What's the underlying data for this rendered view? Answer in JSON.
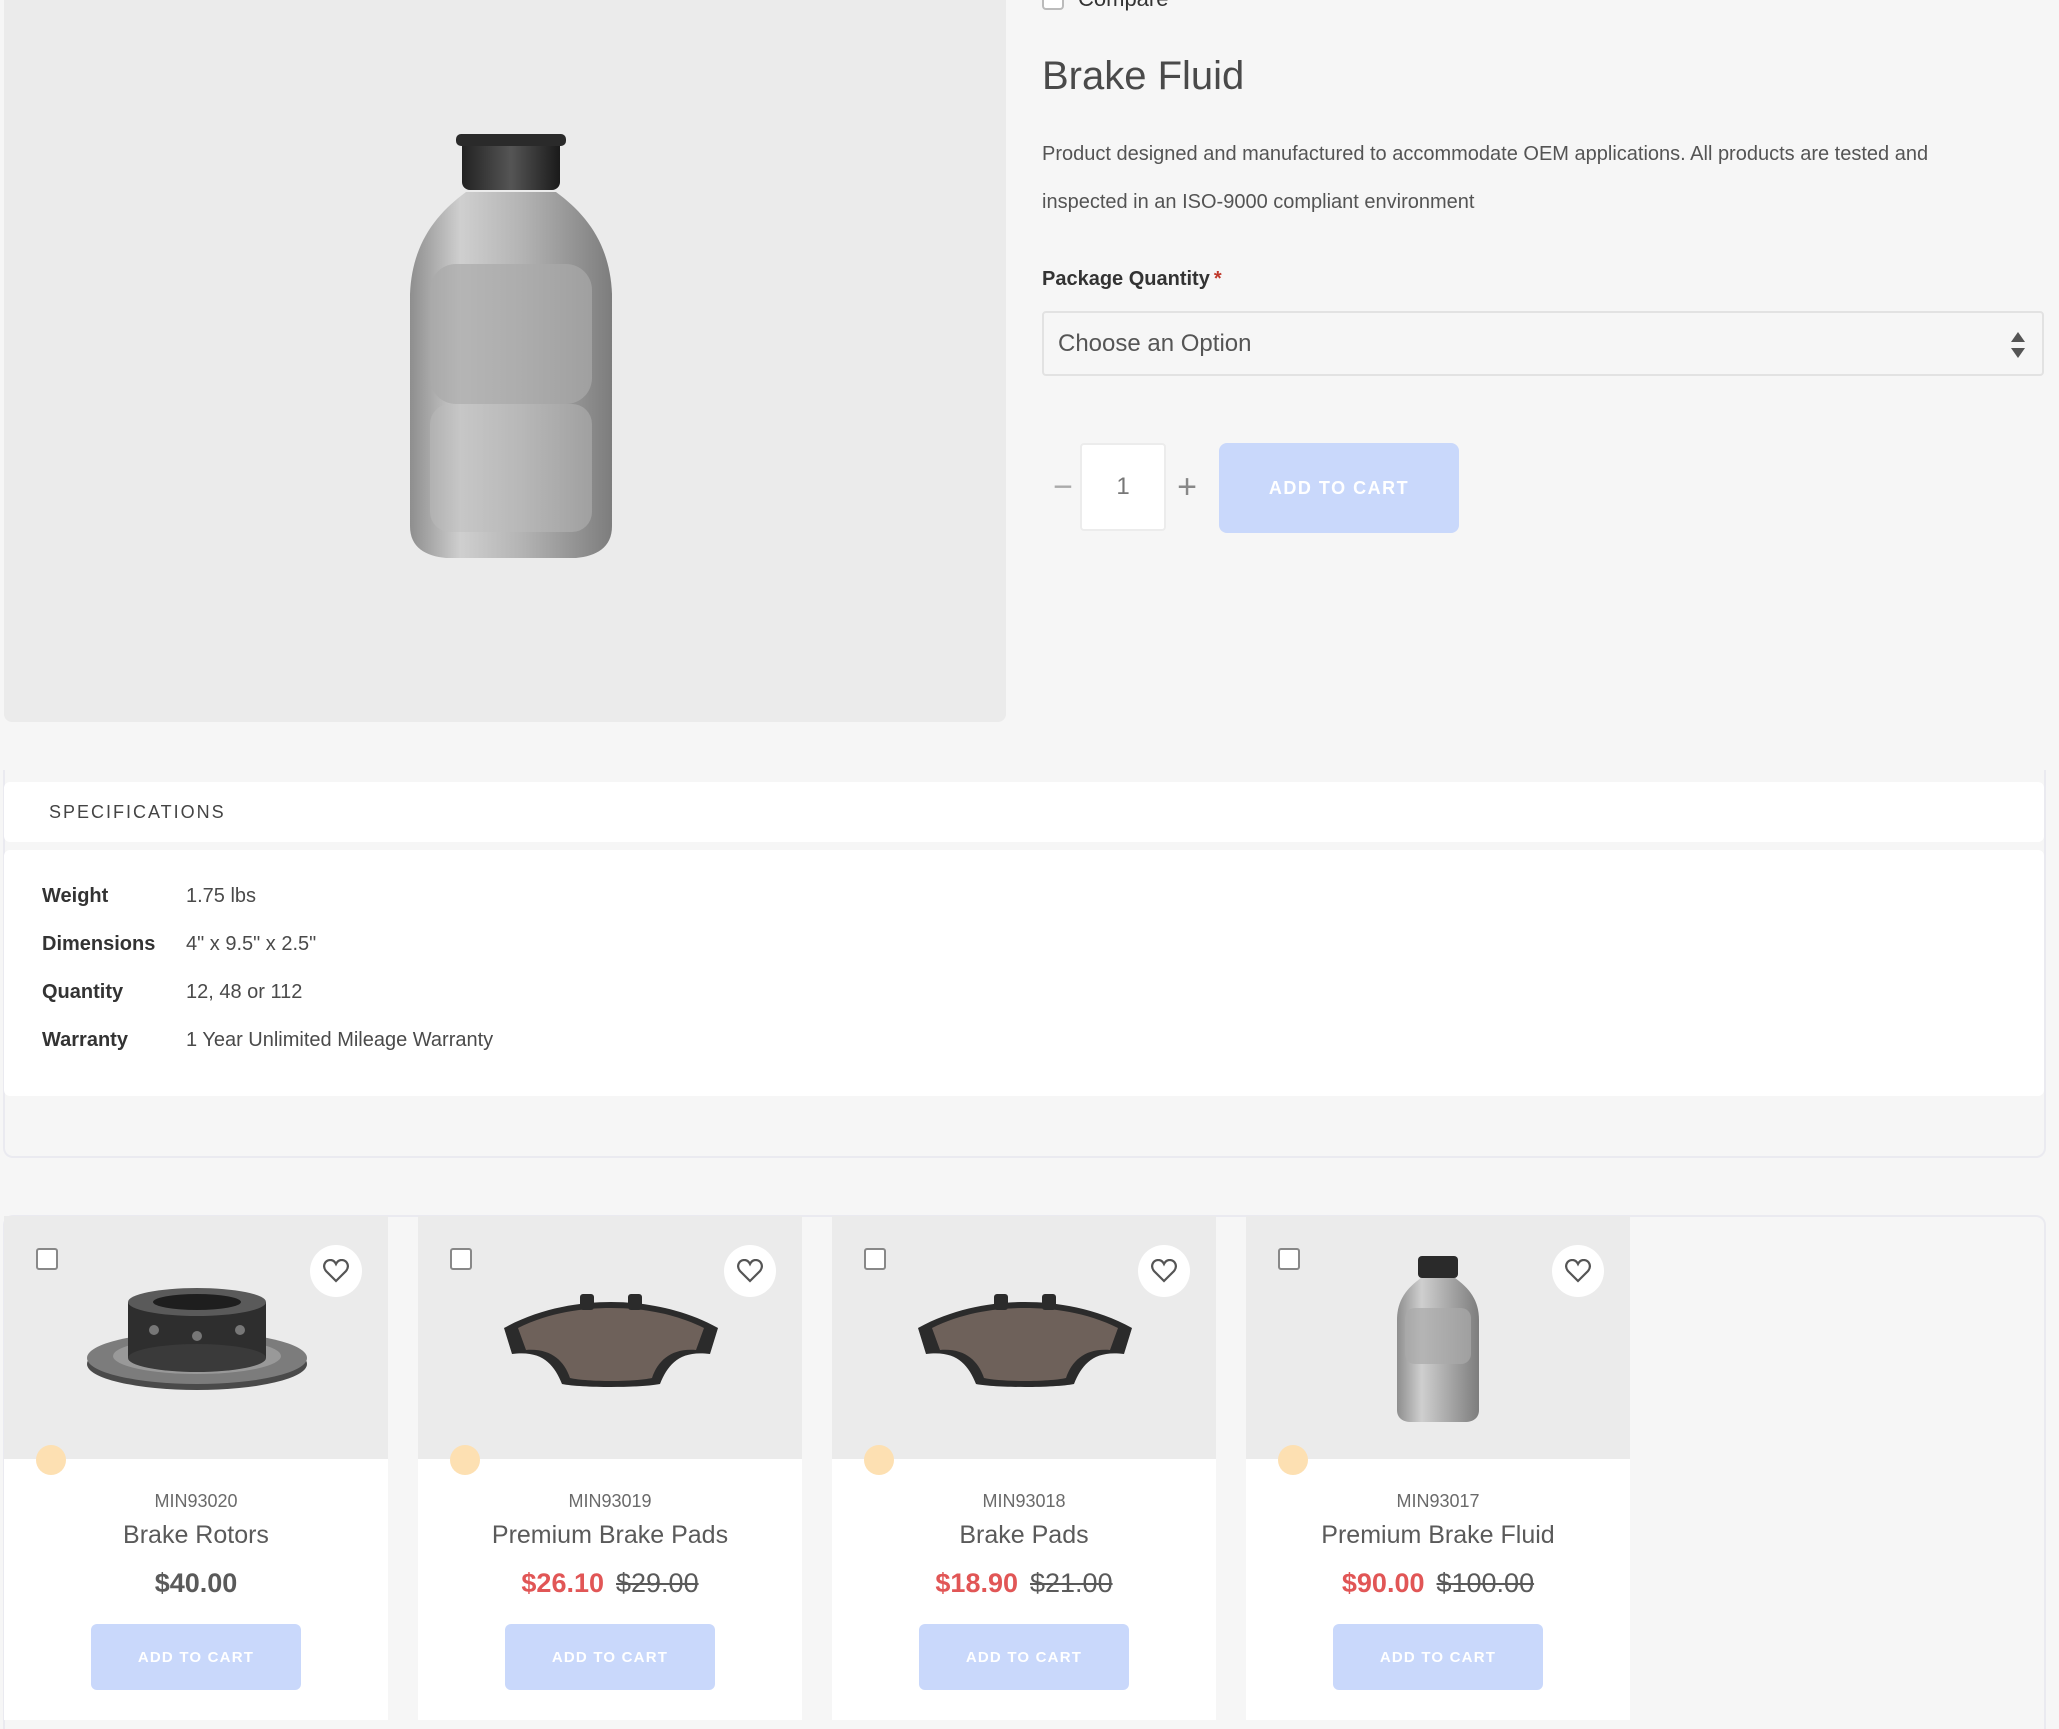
{
  "product": {
    "compare_label": "Compare",
    "title": "Brake Fluid",
    "description": "Product designed and manufactured to accommodate OEM applications. All products are tested and inspected in an ISO-9000 compliant environment",
    "option_label": "Package Quantity",
    "required_mark": "*",
    "option_selected": "Choose an Option",
    "quantity": "1",
    "minus_label": "−",
    "plus_label": "+",
    "add_to_cart": "ADD TO CART",
    "colors": {
      "button_bg": "#c9d8fb",
      "sale": "#e15656",
      "required": "#c0392b"
    }
  },
  "specs": {
    "tab_label": "SPECIFICATIONS",
    "rows": [
      {
        "key": "Weight",
        "value": "1.75 lbs"
      },
      {
        "key": "Dimensions",
        "value": "4\" x 9.5\" x 2.5\""
      },
      {
        "key": "Quantity",
        "value": "12, 48 or 112"
      },
      {
        "key": "Warranty",
        "value": "1 Year Unlimited Mileage Warranty"
      }
    ]
  },
  "related": [
    {
      "sku": "MIN93020",
      "name": "Brake Rotors",
      "price": "$40.00",
      "sale_price": "",
      "old_price": "",
      "button": "ADD TO CART",
      "image": "brake-rotor-icon"
    },
    {
      "sku": "MIN93019",
      "name": "Premium Brake Pads",
      "price": "",
      "sale_price": "$26.10",
      "old_price": "$29.00",
      "button": "ADD TO CART",
      "image": "brake-pad-icon"
    },
    {
      "sku": "MIN93018",
      "name": "Brake Pads",
      "price": "",
      "sale_price": "$18.90",
      "old_price": "$21.00",
      "button": "ADD TO CART",
      "image": "brake-pad-icon"
    },
    {
      "sku": "MIN93017",
      "name": "Premium Brake Fluid",
      "price": "",
      "sale_price": "$90.00",
      "old_price": "$100.00",
      "button": "ADD TO CART",
      "image": "fluid-bottle-icon"
    }
  ]
}
